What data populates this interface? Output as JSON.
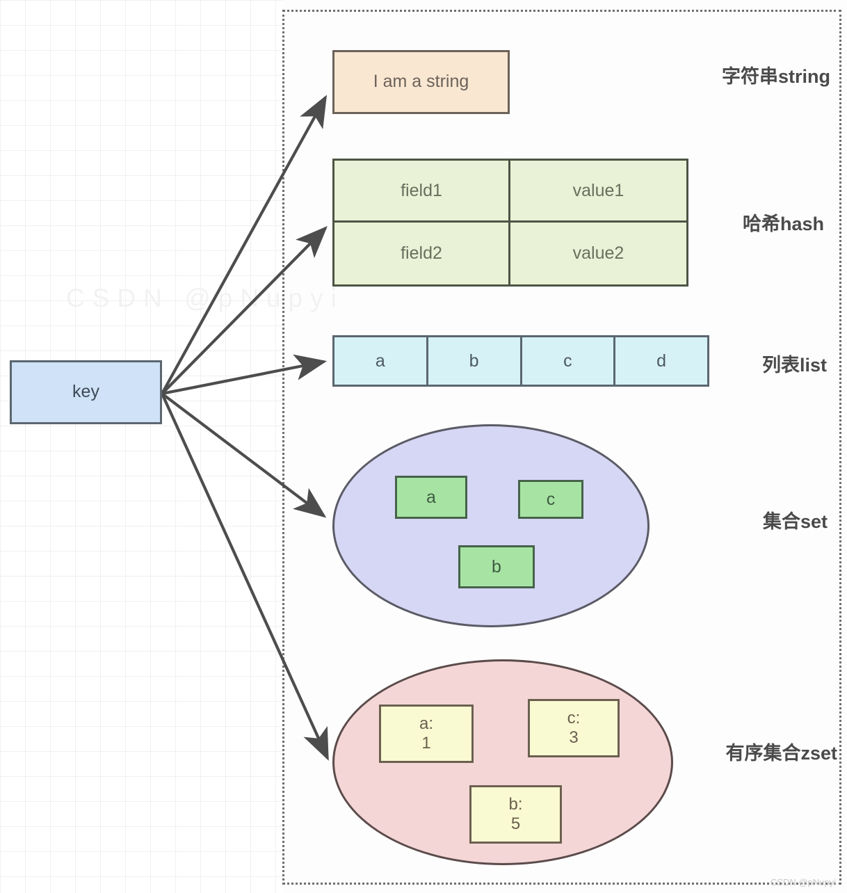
{
  "diagram": {
    "key_node": {
      "label": "key"
    },
    "string": {
      "value": "I am a string",
      "type_label": "字符串string"
    },
    "hash": {
      "rows": [
        {
          "field": "field1",
          "value": "value1"
        },
        {
          "field": "field2",
          "value": "value2"
        }
      ],
      "type_label": "哈希hash"
    },
    "list": {
      "items": [
        "a",
        "b",
        "c",
        "d"
      ],
      "type_label": "列表list"
    },
    "set": {
      "items": [
        "a",
        "c",
        "b"
      ],
      "type_label": "集合set"
    },
    "zset": {
      "items": [
        {
          "member": "a:",
          "score": "1"
        },
        {
          "member": "c:",
          "score": "3"
        },
        {
          "member": "b:",
          "score": "5"
        }
      ],
      "type_label": "有序集合zset"
    },
    "watermark": "CSDN @pNupyi",
    "faint_watermark": "CSDN @pNupyi",
    "colors": {
      "key_fill": "#cfe2f7",
      "string_fill": "#fae7d2",
      "hash_fill": "#e9f2d6",
      "list_fill": "#d6f2f7",
      "set_fill": "#d6d6f5",
      "set_item_fill": "#a7e4a4",
      "zset_fill": "#f5d6d6",
      "zset_item_fill": "#fafad2",
      "arrow": "#4d4d4d",
      "border_dotted": "#6e6e6e"
    }
  }
}
